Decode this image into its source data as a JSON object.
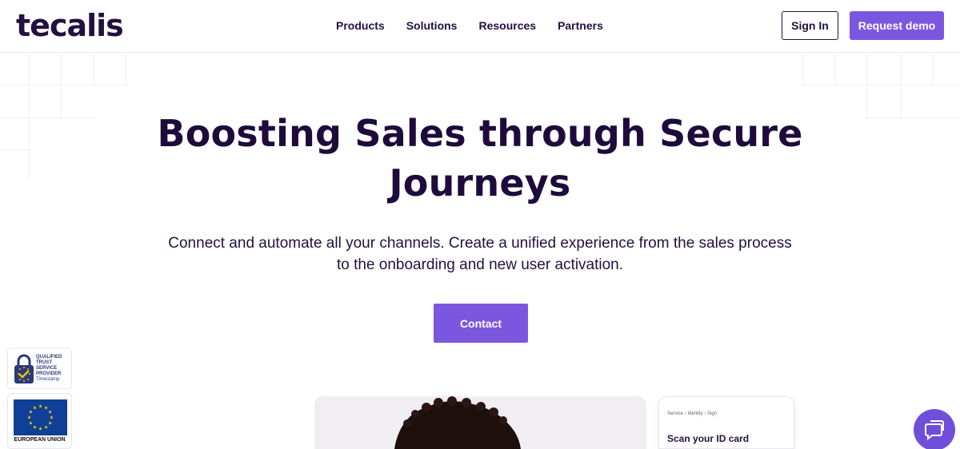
{
  "brand": {
    "logo_text": "tecalis",
    "accent_color": "#7b57e0",
    "dark_color": "#1e0b3c"
  },
  "nav": {
    "items": [
      {
        "label": "Products"
      },
      {
        "label": "Solutions"
      },
      {
        "label": "Resources"
      },
      {
        "label": "Partners"
      }
    ],
    "sign_in_label": "Sign In",
    "request_demo_label": "Request demo"
  },
  "hero": {
    "title": "Boosting Sales through Secure Journeys",
    "subtitle": "Connect and automate all your channels. Create a unified experience from the sales process to the onboarding and new user activation.",
    "cta_label": "Contact"
  },
  "badges": {
    "trust_lines": [
      "QUALIFIED",
      "TRUST",
      "SERVICE",
      "PROVIDER"
    ],
    "trust_sub": "Timestamp",
    "eu_label": "EUROPEAN UNION"
  },
  "id_card": {
    "breadcrumb": [
      "Service",
      "Identity",
      "Sign"
    ],
    "title": "Scan your ID card"
  },
  "icons": {
    "chat": "chat-icon",
    "lock": "lock-check-icon",
    "eu_flag": "eu-flag-icon"
  }
}
